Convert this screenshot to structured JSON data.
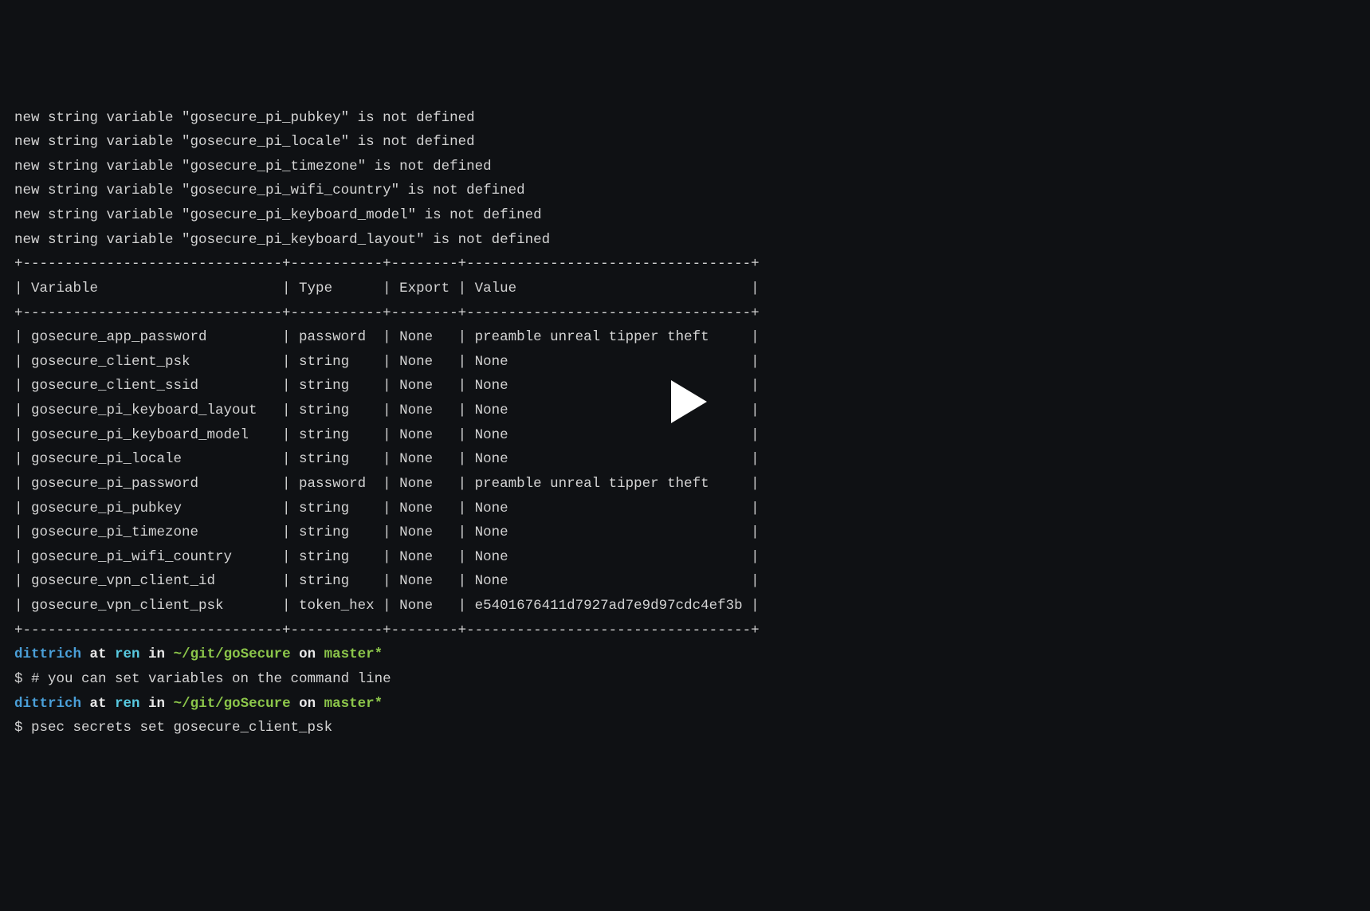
{
  "warnings": [
    "new string variable \"gosecure_pi_pubkey\" is not defined",
    "new string variable \"gosecure_pi_locale\" is not defined",
    "new string variable \"gosecure_pi_timezone\" is not defined",
    "new string variable \"gosecure_pi_wifi_country\" is not defined",
    "new string variable \"gosecure_pi_keyboard_model\" is not defined",
    "new string variable \"gosecure_pi_keyboard_layout\" is not defined"
  ],
  "table": {
    "border_top": "+-------------------------------+-----------+--------+----------------------------------+",
    "header": "| Variable                      | Type      | Export | Value                            |",
    "border_mid": "+-------------------------------+-----------+--------+----------------------------------+",
    "rows": [
      "| gosecure_app_password         | password  | None   | preamble unreal tipper theft     |",
      "| gosecure_client_psk           | string    | None   | None                             |",
      "| gosecure_client_ssid          | string    | None   | None                             |",
      "| gosecure_pi_keyboard_layout   | string    | None   | None                             |",
      "| gosecure_pi_keyboard_model    | string    | None   | None                             |",
      "| gosecure_pi_locale            | string    | None   | None                             |",
      "| gosecure_pi_password          | password  | None   | preamble unreal tipper theft     |",
      "| gosecure_pi_pubkey            | string    | None   | None                             |",
      "| gosecure_pi_timezone          | string    | None   | None                             |",
      "| gosecure_pi_wifi_country      | string    | None   | None                             |",
      "| gosecure_vpn_client_id        | string    | None   | None                             |",
      "| gosecure_vpn_client_psk       | token_hex | None   | e5401676411d7927ad7e9d97cdc4ef3b |"
    ],
    "border_bot": "+-------------------------------+-----------+--------+----------------------------------+"
  },
  "prompt1": {
    "user": "dittrich",
    "at": " at ",
    "host": "ren",
    "in": " in ",
    "path": "~/git/goSecure",
    "on": " on ",
    "branch": "master*"
  },
  "cmd1": "$ # you can set variables on the command line",
  "prompt2": {
    "user": "dittrich",
    "at": " at ",
    "host": "ren",
    "in": " in ",
    "path": "~/git/goSecure",
    "on": " on ",
    "branch": "master*"
  },
  "cmd2": "$ psec secrets set gosecure_client_psk"
}
